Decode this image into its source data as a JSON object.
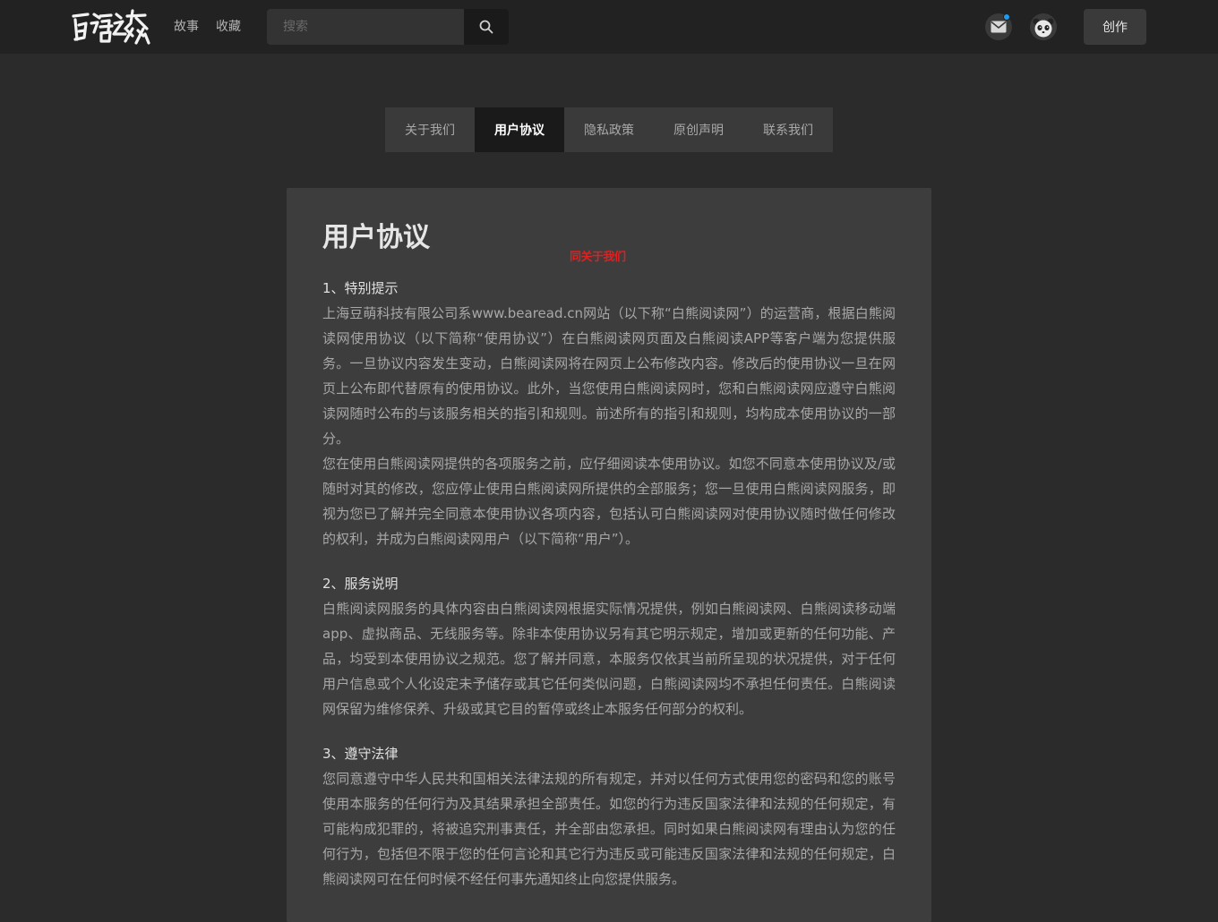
{
  "header": {
    "logo_alt": "白熊之森",
    "nav": [
      "故事",
      "收藏"
    ],
    "search": {
      "placeholder": "搜索",
      "value": ""
    },
    "create_label": "创作",
    "notification_dot_color": "#1e9bf0",
    "icons": [
      "search-icon",
      "mail-icon",
      "avatar"
    ]
  },
  "tabs": [
    {
      "label": "关于我们",
      "active": false
    },
    {
      "label": "用户协议",
      "active": true
    },
    {
      "label": "隐私政策",
      "active": false
    },
    {
      "label": "原创声明",
      "active": false
    },
    {
      "label": "联系我们",
      "active": false
    }
  ],
  "article": {
    "title": "用户协议",
    "red_note": "同关于我们",
    "sections": [
      {
        "heading": "1、特别提示",
        "paragraphs": [
          "上海豆萌科技有限公司系www.bearead.cn网站（以下称“白熊阅读网”）的运营商，根据白熊阅读网使用协议（以下简称“使用协议”）在白熊阅读网页面及白熊阅读APP等客户端为您提供服务。一旦协议内容发生变动，白熊阅读网将在网页上公布修改内容。修改后的使用协议一旦在网页上公布即代替原有的使用协议。此外，当您使用白熊阅读网时，您和白熊阅读网应遵守白熊阅读网随时公布的与该服务相关的指引和规则。前述所有的指引和规则，均构成本使用协议的一部分。",
          "您在使用白熊阅读网提供的各项服务之前，应仔细阅读本使用协议。如您不同意本使用协议及/或随时对其的修改，您应停止使用白熊阅读网所提供的全部服务；您一旦使用白熊阅读网服务，即视为您已了解并完全同意本使用协议各项内容，包括认可白熊阅读网对使用协议随时做任何修改的权利，并成为白熊阅读网用户（以下简称“用户”）。"
        ]
      },
      {
        "heading": "2、服务说明",
        "paragraphs": [
          "白熊阅读网服务的具体内容由白熊阅读网根据实际情况提供，例如白熊阅读网、白熊阅读移动端app、虚拟商品、无线服务等。除非本使用协议另有其它明示规定，增加或更新的任何功能、产品，均受到本使用协议之规范。您了解并同意，本服务仅依其当前所呈现的状况提供，对于任何用户信息或个人化设定未予储存或其它任何类似问题，白熊阅读网均不承担任何责任。白熊阅读网保留为维修保养、升级或其它目的暂停或终止本服务任何部分的权利。"
        ]
      },
      {
        "heading": "3、遵守法律",
        "paragraphs": [
          "您同意遵守中华人民共和国相关法律法规的所有规定，并对以任何方式使用您的密码和您的账号使用本服务的任何行为及其结果承担全部责任。如您的行为违反国家法律和法规的任何规定，有可能构成犯罪的，将被追究刑事责任，并全部由您承担。同时如果白熊阅读网有理由认为您的任何行为，包括但不限于您的任何言论和其它行为违反或可能违反国家法律和法规的任何规定，白熊阅读网可在任何时候不经任何事先通知终止向您提供服务。"
        ]
      }
    ]
  }
}
